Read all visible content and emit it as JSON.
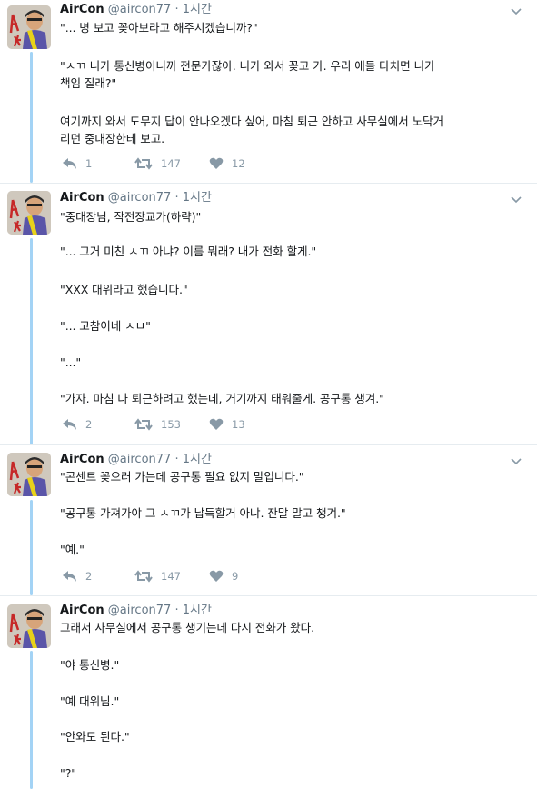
{
  "author": {
    "name": "AirCon",
    "handle": "@aircon77",
    "separator": "·",
    "time": "1시간"
  },
  "tweets": [
    {
      "paragraphs": [
        "\"... 병 보고 꽂아보라고 해주시겠습니까?\"",
        "\"ㅅㄲ 니가 통신병이니까 전문가잖아. 니가 와서 꽂고 가. 우리 애들 다치면 니가\n책임 질래?\"",
        "여기까지 와서 도무지 답이 안나오겠다 싶어, 마침 퇴근 안하고 사무실에서 노닥거\n리던 중대장한테 보고."
      ],
      "replies": "1",
      "retweets": "147",
      "likes": "12"
    },
    {
      "paragraphs": [
        "\"중대장님, 작전장교가(하략)\"",
        "\"... 그거 미친 ㅅㄲ 아냐? 이름 뭐래? 내가 전화 할게.\"",
        "\"XXX 대위라고 했습니다.\"",
        "\"... 고참이네 ㅅㅂ\"",
        "\"...\"",
        "\"가자. 마침 나 퇴근하려고 했는데, 거기까지 태워줄게. 공구통 챙겨.\""
      ],
      "replies": "2",
      "retweets": "153",
      "likes": "13"
    },
    {
      "paragraphs": [
        "\"콘센트 꽂으러 가는데 공구통 필요 없지 말입니다.\"",
        "\"공구통 가져가야 그 ㅅㄲ가 납득할거 아냐. 잔말 말고 챙겨.\"",
        "\"예.\""
      ],
      "replies": "2",
      "retweets": "147",
      "likes": "9"
    },
    {
      "paragraphs": [
        "그래서 사무실에서 공구통 챙기는데 다시 전화가 왔다.",
        "\"야 통신병.\"",
        "\"예 대위님.\"",
        "\"안와도 된다.\"",
        "\"?\""
      ]
    }
  ],
  "icons": [
    "chevron-down-icon",
    "reply-icon",
    "retweet-icon",
    "like-icon"
  ],
  "colors": {
    "thread_line": "#a3d3f5",
    "muted": "#657786",
    "icon": "#8899a6",
    "text": "#14171a",
    "divider": "#e6ecf0"
  }
}
